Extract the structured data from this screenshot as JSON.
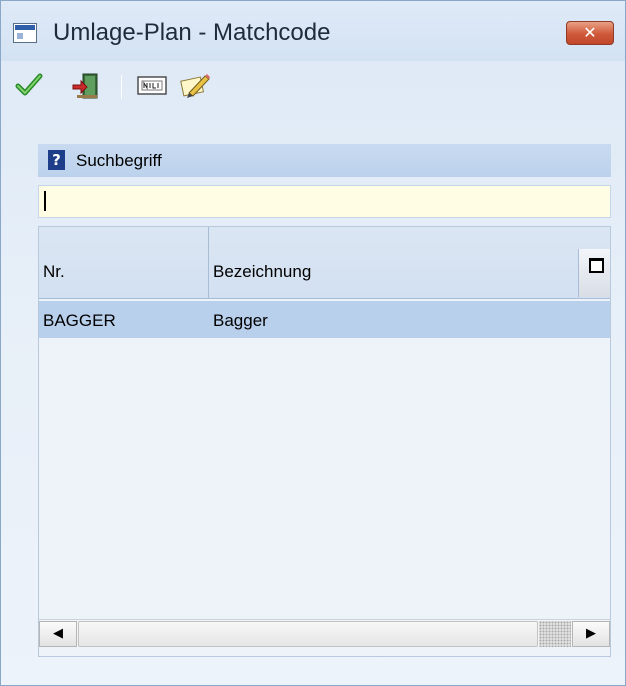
{
  "window": {
    "title": "Umlage-Plan - Matchcode",
    "close_label": "✕"
  },
  "toolbar": {
    "buttons": [
      {
        "icon": "checkmark-icon",
        "label": ""
      },
      {
        "icon": "exit-door-icon",
        "label": ""
      },
      {
        "icon": "new-record-icon",
        "label": ""
      },
      {
        "icon": "edit-pencil-icon",
        "label": ""
      }
    ]
  },
  "search": {
    "label": "Suchbegriff",
    "help_glyph": "?",
    "value": "",
    "placeholder": ""
  },
  "grid": {
    "columns": [
      "Nr.",
      "Bezeichnung"
    ],
    "rows": [
      {
        "nr": "BAGGER",
        "bezeichnung": "Bagger"
      }
    ]
  },
  "scrollbar": {
    "left_glyph": "◀",
    "right_glyph": "▶"
  },
  "colors": {
    "accent": "#bcd2ec",
    "selected_row": "#b9d0ec",
    "input_background": "#fffde3",
    "close_button": "#d0593a"
  }
}
